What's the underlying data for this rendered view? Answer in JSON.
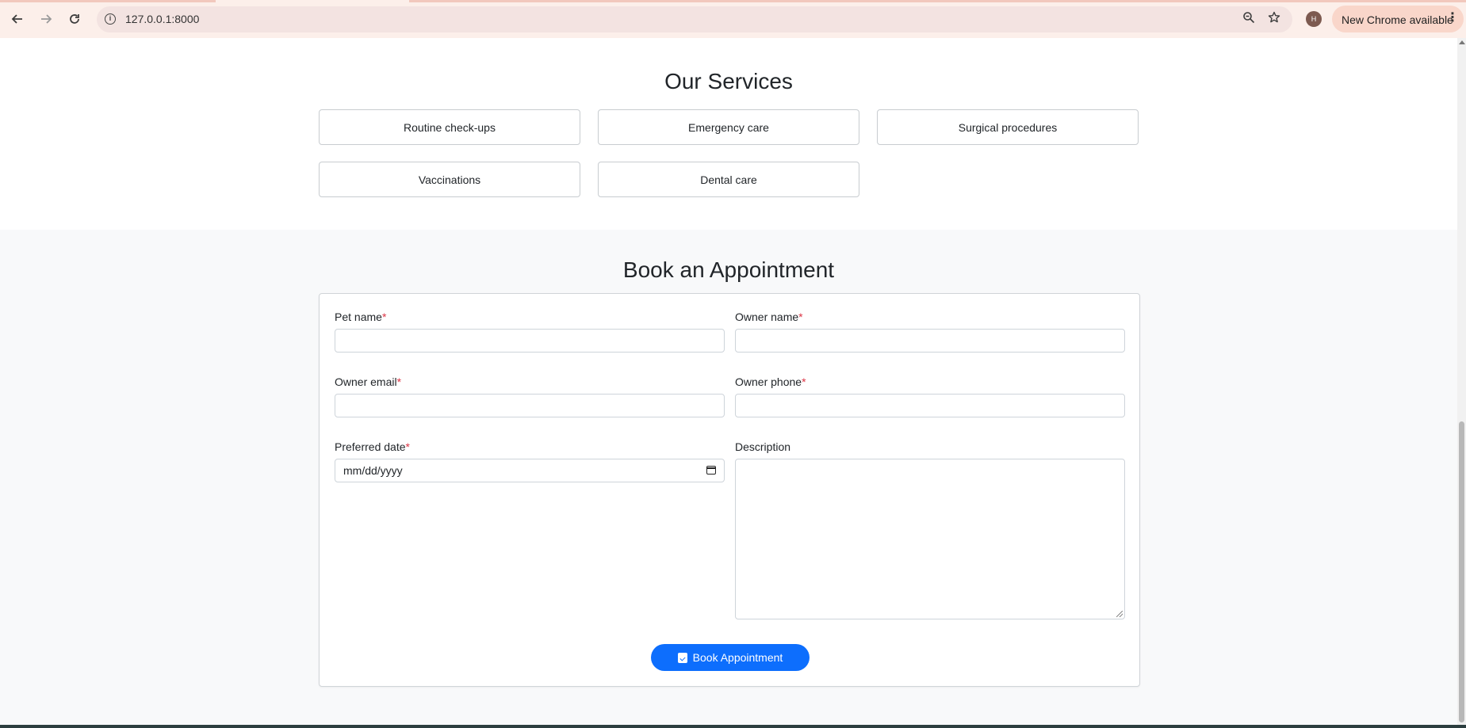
{
  "browser": {
    "url": "127.0.0.1:8000",
    "back_icon": "arrow-left",
    "forward_icon": "arrow-right",
    "reload_icon": "reload",
    "profile_initial": "H",
    "update_label": "New Chrome available",
    "accent_color": "#fcefea"
  },
  "services": {
    "title": "Our Services",
    "items": [
      "Routine check-ups",
      "Emergency care",
      "Surgical procedures",
      "Vaccinations",
      "Dental care"
    ]
  },
  "booking": {
    "title": "Book an Appointment",
    "fields": {
      "pet_name": {
        "label": "Pet name",
        "required": "*"
      },
      "owner_name": {
        "label": "Owner name",
        "required": "*"
      },
      "owner_email": {
        "label": "Owner email",
        "required": "*"
      },
      "owner_phone": {
        "label": "Owner phone",
        "required": "*"
      },
      "preferred_date": {
        "label": "Preferred date",
        "required": "*",
        "placeholder": "mm/dd/yyyy"
      },
      "description": {
        "label": "Description"
      }
    },
    "submit_label": "Book Appointment",
    "button_color": "#0d6efd"
  }
}
